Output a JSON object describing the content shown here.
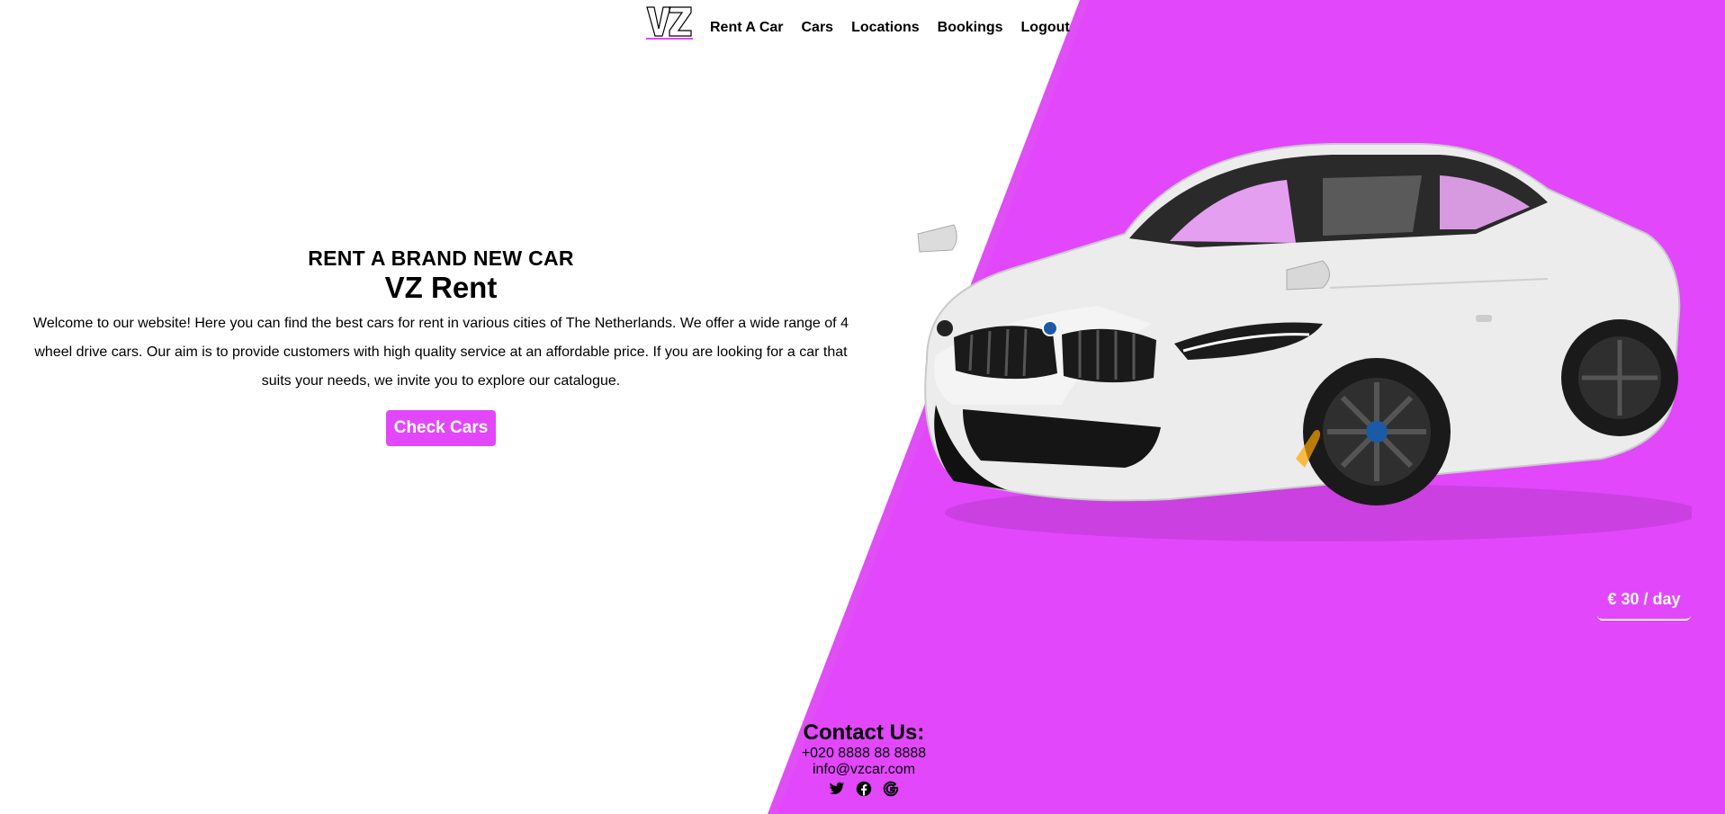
{
  "nav": {
    "logo_text": "VZ",
    "links": [
      {
        "label": "Rent A Car"
      },
      {
        "label": "Cars"
      },
      {
        "label": "Locations"
      },
      {
        "label": "Bookings"
      },
      {
        "label": "Logout"
      }
    ]
  },
  "hero": {
    "subtitle": "RENT A BRAND NEW CAR",
    "title": "VZ Rent",
    "description": "Welcome to our website! Here you can find the best cars for rent in various cities of The Netherlands. We offer a wide range of 4 wheel drive cars. Our aim is to provide customers with high quality service at an affordable price. If you are looking for a car that suits your needs, we invite you to explore our catalogue.",
    "button_label": "Check Cars"
  },
  "price": {
    "label": "€ 30 / day"
  },
  "contact": {
    "title": "Contact Us:",
    "phone": "+020 8888 88 8888",
    "email": "info@vzcar.com",
    "socials": [
      "twitter-icon",
      "facebook-icon",
      "google-icon"
    ]
  },
  "colors": {
    "accent": "#e247fc",
    "text": "#000000",
    "background": "#ffffff"
  }
}
